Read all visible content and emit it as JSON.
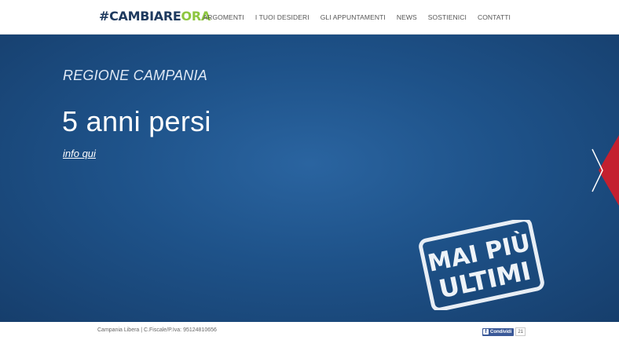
{
  "brand": {
    "hash": "#",
    "cambiare": "CAMBIARE",
    "ora": "ORA"
  },
  "nav": {
    "items": [
      {
        "label": "ARGOMENTI"
      },
      {
        "label": "I TUOI DESIDERI"
      },
      {
        "label": "GLI APPUNTAMENTI"
      },
      {
        "label": "NEWS"
      },
      {
        "label": "SOSTIENICI"
      },
      {
        "label": "CONTATTI"
      }
    ]
  },
  "hero": {
    "region": "REGIONE CAMPANIA",
    "headline": "5 anni persi",
    "link": "info qui",
    "stamp_line1": "MAI PIÙ",
    "stamp_line2": "ULTIMI"
  },
  "footer": {
    "copyright": "Campania Libera | C.Fiscale/P.Iva: 95124810656",
    "share_label": "Condividi",
    "share_count": "21"
  },
  "colors": {
    "brand_dark": "#1e3a5f",
    "brand_green": "#8dc63f",
    "hero_blue": "#1e5289",
    "accent_red": "#c4202f",
    "facebook": "#3b5998"
  },
  "icons": {
    "next": "chevron-right-icon",
    "facebook": "facebook-icon"
  }
}
